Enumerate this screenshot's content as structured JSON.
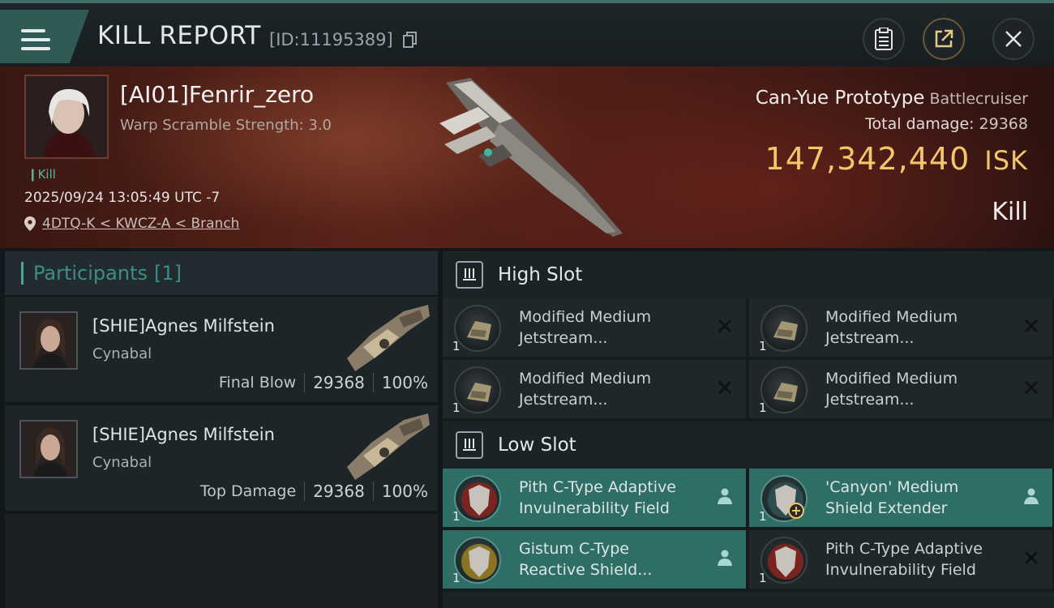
{
  "header": {
    "title": "KILL REPORT",
    "report_id": "[ID:11195389]",
    "icons": [
      "menu-icon",
      "copy-icon",
      "clipboard-icon",
      "export-icon",
      "close-icon"
    ]
  },
  "victim": {
    "name": "[AI01]Fenrir_zero",
    "warp": "Warp Scramble Strength: 3.0",
    "tag": "Kill",
    "datetime": "2025/09/24 13:05:49 UTC -7",
    "location": "4DTQ-K < KWCZ-A < Branch",
    "ship_name": "Can-Yue Prototype",
    "ship_class": "Battlecruiser",
    "total_damage_label": "Total damage:",
    "total_damage": "29368",
    "isk_value": "147,342,440",
    "isk_unit": "ISK",
    "result": "Kill"
  },
  "participants": {
    "label": "Participants",
    "count": "[1]",
    "list": [
      {
        "name": "[SHIE]Agnes Milfstein",
        "ship": "Cynabal",
        "role": "Final Blow",
        "damage": "29368",
        "percent": "100%"
      },
      {
        "name": "[SHIE]Agnes Milfstein",
        "ship": "Cynabal",
        "role": "Top Damage",
        "damage": "29368",
        "percent": "100%"
      }
    ]
  },
  "fittings": {
    "high_slot": {
      "title": "High Slot",
      "modules": [
        {
          "name_line1": "Modified Medium",
          "name_line2": "Jetstream...",
          "qty": "1",
          "state": "destroyed"
        },
        {
          "name_line1": "Modified Medium",
          "name_line2": "Jetstream...",
          "qty": "1",
          "state": "destroyed"
        },
        {
          "name_line1": "Modified Medium",
          "name_line2": "Jetstream...",
          "qty": "1",
          "state": "destroyed"
        },
        {
          "name_line1": "Modified Medium",
          "name_line2": "Jetstream...",
          "qty": "1",
          "state": "destroyed"
        }
      ]
    },
    "low_slot": {
      "title": "Low Slot",
      "modules": [
        {
          "name_line1": "Pith C-Type Adaptive",
          "name_line2": "Invulnerability Field",
          "qty": "1",
          "state": "dropped"
        },
        {
          "name_line1": "'Canyon' Medium",
          "name_line2": "Shield Extender",
          "qty": "1",
          "state": "dropped"
        },
        {
          "name_line1": "Gistum C-Type",
          "name_line2": "Reactive Shield...",
          "qty": "1",
          "state": "dropped"
        },
        {
          "name_line1": "Pith C-Type Adaptive",
          "name_line2": "Invulnerability Field",
          "qty": "1",
          "state": "destroyed"
        }
      ]
    }
  },
  "colors": {
    "accent_teal": "#2f6e66",
    "isk_gold": "#f2c66a",
    "banner_red": "#5a241a"
  }
}
